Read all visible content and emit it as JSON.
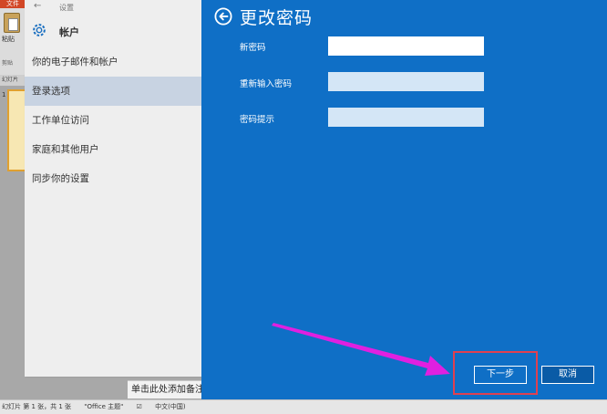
{
  "background_app": {
    "file_tab": "文件",
    "paste_label": "粘贴",
    "clipboard_label": "剪贴",
    "thumbs_header": "幻灯片",
    "slide_number": "1",
    "notes_placeholder": "单击此处添加备注",
    "status_bar": {
      "slide_info": "幻灯片 第 1 张，共 1 张",
      "theme": "\"Office 主题\"",
      "language": "中文(中国)"
    }
  },
  "settings": {
    "window_title": "设置",
    "heading": "帐户",
    "nav_items": [
      {
        "label": "你的电子邮件和帐户",
        "active": false
      },
      {
        "label": "登录选项",
        "active": true
      },
      {
        "label": "工作单位访问",
        "active": false
      },
      {
        "label": "家庭和其他用户",
        "active": false
      },
      {
        "label": "同步你的设置",
        "active": false
      }
    ]
  },
  "change_password": {
    "title": "更改密码",
    "fields": {
      "new_password": {
        "label": "新密码",
        "value": ""
      },
      "reenter_password": {
        "label": "重新输入密码",
        "value": ""
      },
      "password_hint": {
        "label": "密码提示",
        "value": ""
      }
    },
    "next_button": "下一步",
    "cancel_button": "取消"
  },
  "colors": {
    "panel_blue": "#0f6fc6",
    "highlight_red": "#e04050",
    "arrow_magenta": "#e020e0"
  }
}
